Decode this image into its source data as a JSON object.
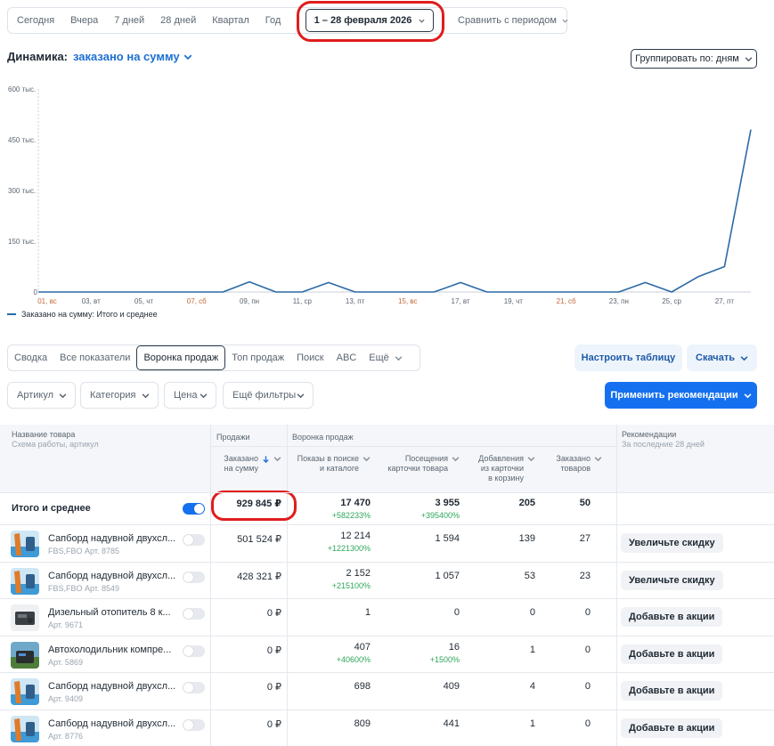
{
  "period_bar": {
    "options": [
      "Сегодня",
      "Вчера",
      "7 дней",
      "28 дней",
      "Квартал",
      "Год"
    ],
    "selected_range": "1 – 28 февраля 2026",
    "compare_label": "Сравнить с периодом"
  },
  "dynamics": {
    "label": "Динамика:",
    "metric": "заказано на сумму",
    "group_by": "Группировать по: дням"
  },
  "chart_data": {
    "type": "line",
    "y_ticks": [
      "600 тыс.",
      "450 тыс.",
      "300 тыс.",
      "150 тыс.",
      "0"
    ],
    "ylim": [
      0,
      600000
    ],
    "x_ticks": [
      {
        "label": "01, вс",
        "weekend": true
      },
      {
        "label": "03, вт",
        "weekend": false
      },
      {
        "label": "05, чт",
        "weekend": false
      },
      {
        "label": "07, сб",
        "weekend": true
      },
      {
        "label": "09, пн",
        "weekend": false
      },
      {
        "label": "11, ср",
        "weekend": false
      },
      {
        "label": "13, пт",
        "weekend": false
      },
      {
        "label": "15, вс",
        "weekend": true
      },
      {
        "label": "17, вт",
        "weekend": false
      },
      {
        "label": "19, чт",
        "weekend": false
      },
      {
        "label": "21, сб",
        "weekend": true
      },
      {
        "label": "23, пн",
        "weekend": false
      },
      {
        "label": "25, ср",
        "weekend": false
      },
      {
        "label": "27, пт",
        "weekend": false
      }
    ],
    "x": [
      1,
      2,
      3,
      4,
      5,
      6,
      7,
      8,
      9,
      10,
      11,
      12,
      13,
      14,
      15,
      16,
      17,
      18,
      19,
      20,
      21,
      22,
      23,
      24,
      25,
      26,
      27,
      28
    ],
    "series": [
      {
        "name": "Заказано на сумму: Итого и среднее",
        "values": [
          0,
          0,
          0,
          0,
          0,
          0,
          0,
          0,
          30000,
          0,
          0,
          28000,
          0,
          0,
          0,
          0,
          28000,
          0,
          0,
          0,
          0,
          0,
          0,
          28000,
          0,
          45000,
          75000,
          480000
        ]
      }
    ],
    "line_color": "#2b6aa6",
    "weekend_color": "#c0693a",
    "grid": false
  },
  "tabs": [
    "Сводка",
    "Все показатели",
    "Воронка продаж",
    "Топ продаж",
    "Поиск",
    "ABC",
    "Ещё"
  ],
  "active_tab": "Воронка продаж",
  "toolbar": {
    "configure_table": "Настроить таблицу",
    "download": "Скачать",
    "apply_recommendations": "Применить рекомендации"
  },
  "filters": [
    "Артикул",
    "Категория",
    "Цена",
    "Ещё фильтры"
  ],
  "table": {
    "col_name": "Название товара",
    "col_name_sub": "Схема работы, артикул",
    "group_sales": "Продажи",
    "group_funnel": "Воронка продаж",
    "col_rec": "Рекомендации",
    "col_rec_sub": "За последние 28 дней",
    "columns": [
      [
        "Заказано",
        "на сумму"
      ],
      [
        "Показы в поиске",
        "и каталоге"
      ],
      [
        "Посещения",
        "карточки товара"
      ],
      [
        "Добавления",
        "из карточки",
        "в корзину"
      ],
      [
        "Заказано",
        "товаров"
      ]
    ],
    "total": {
      "label": "Итого и среднее",
      "ordered_sum": "929 845 ₽",
      "impressions": "17 470",
      "impressions_delta": "+582233%",
      "visits": "3 955",
      "visits_delta": "+395400%",
      "cart_adds": "205",
      "ordered_qty": "50"
    },
    "rows": [
      {
        "name": "Сапборд надувной двухсл...",
        "meta": "FBS,FBO Арт. 8785",
        "ordered_sum": "501 524 ₽",
        "impressions": "12 214",
        "impressions_delta": "+1221300%",
        "visits": "1 594",
        "visits_delta": "",
        "cart_adds": "139",
        "ordered_qty": "27",
        "rec": "Увеличьте скидку",
        "thumb": "sup"
      },
      {
        "name": "Сапборд надувной двухсл...",
        "meta": "FBS,FBO Арт. 8549",
        "ordered_sum": "428 321 ₽",
        "impressions": "2 152",
        "impressions_delta": "+215100%",
        "visits": "1 057",
        "visits_delta": "",
        "cart_adds": "53",
        "ordered_qty": "23",
        "rec": "Увеличьте скидку",
        "thumb": "sup"
      },
      {
        "name": "Дизельный отопитель 8 к...",
        "meta": "Арт. 9671",
        "ordered_sum": "0 ₽",
        "impressions": "1",
        "impressions_delta": "",
        "visits": "0",
        "visits_delta": "",
        "cart_adds": "0",
        "ordered_qty": "0",
        "rec": "Добавьте в акции",
        "thumb": "heater"
      },
      {
        "name": "Автохолодильник компре...",
        "meta": "Арт. 5869",
        "ordered_sum": "0 ₽",
        "impressions": "407",
        "impressions_delta": "+40600%",
        "visits": "16",
        "visits_delta": "+1500%",
        "cart_adds": "1",
        "ordered_qty": "0",
        "rec": "Добавьте в акции",
        "thumb": "fridge"
      },
      {
        "name": "Сапборд надувной двухсл...",
        "meta": "Арт. 9409",
        "ordered_sum": "0 ₽",
        "impressions": "698",
        "impressions_delta": "",
        "visits": "409",
        "visits_delta": "",
        "cart_adds": "4",
        "ordered_qty": "0",
        "rec": "Добавьте в акции",
        "thumb": "sup"
      },
      {
        "name": "Сапборд надувной двухсл...",
        "meta": "Арт. 8776",
        "ordered_sum": "0 ₽",
        "impressions": "809",
        "impressions_delta": "",
        "visits": "441",
        "visits_delta": "",
        "cart_adds": "1",
        "ordered_qty": "0",
        "rec": "Добавьте в акции",
        "thumb": "sup"
      }
    ]
  },
  "colors": {
    "accent_blue": "#1570ef",
    "link_blue": "#1d6fd1",
    "positive_green": "#2ca65a",
    "highlight_red": "#e01d1d"
  }
}
